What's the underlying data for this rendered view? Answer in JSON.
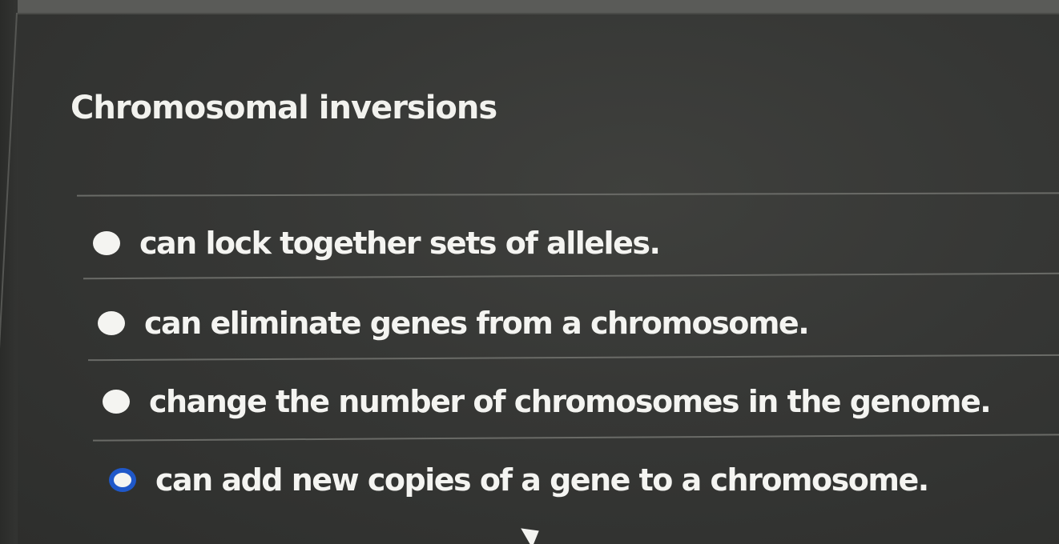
{
  "question": {
    "title": "Chromosomal inversions"
  },
  "options": [
    {
      "label": "can lock together sets of alleles.",
      "selected": false
    },
    {
      "label": "can eliminate genes from a chromosome.",
      "selected": false
    },
    {
      "label": "change the number of chromosomes in the genome.",
      "selected": false
    },
    {
      "label": "can add new copies of a gene to a chromosome.",
      "selected": true
    }
  ],
  "colors": {
    "background": "#363735",
    "text": "#f4f4f1",
    "selected_radio": "#1f58c9",
    "divider": "#6a6b67"
  },
  "icons": {
    "radio": "radio-button-icon",
    "cursor": "mouse-pointer-icon"
  }
}
